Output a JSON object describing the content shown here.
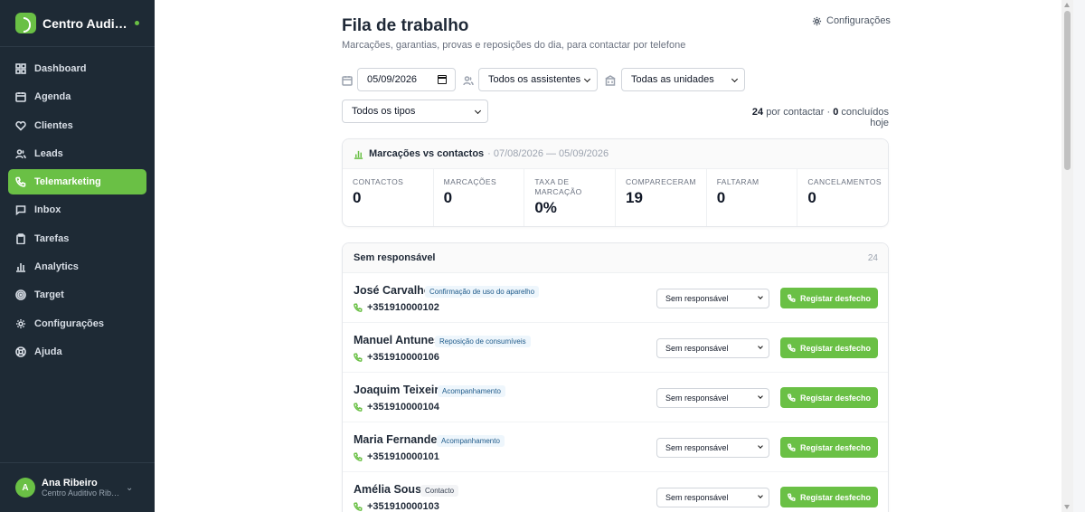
{
  "brand": {
    "name": "Centro Auditivo"
  },
  "nav": [
    {
      "label": "Dashboard",
      "icon": "dashboard-icon"
    },
    {
      "label": "Agenda",
      "icon": "calendar-icon"
    },
    {
      "label": "Clientes",
      "icon": "heart-icon"
    },
    {
      "label": "Leads",
      "icon": "users-icon"
    },
    {
      "label": "Telemarketing",
      "icon": "phone-icon",
      "active": true
    },
    {
      "label": "Inbox",
      "icon": "chat-icon"
    },
    {
      "label": "Tarefas",
      "icon": "clipboard-icon"
    },
    {
      "label": "Analytics",
      "icon": "bar-chart-icon"
    },
    {
      "label": "Target",
      "icon": "target-icon"
    },
    {
      "label": "Configurações",
      "icon": "gear-icon"
    },
    {
      "label": "Ajuda",
      "icon": "help-icon"
    }
  ],
  "user": {
    "initial": "A",
    "name": "Ana Ribeiro",
    "org": "Centro Auditivo Ribeiro"
  },
  "header": {
    "title": "Fila de trabalho",
    "subtitle": "Marcações, garantias, provas e reposições do dia, para contactar por telefone",
    "settings_label": "Configurações"
  },
  "filters": {
    "date": "05/09/2026",
    "assistants": "Todos os assistentes",
    "units": "Todas as unidades",
    "types": "Todos os tipos"
  },
  "counts": {
    "to_contact": "24",
    "to_contact_label": "por contactar ·",
    "done": "0",
    "done_label": "concluídos hoje"
  },
  "stats": {
    "title": "Marcações vs contactos",
    "range": "· 07/08/2026 — 05/09/2026",
    "items": [
      {
        "label": "Contactos",
        "value": "0"
      },
      {
        "label": "Marcações",
        "value": "0"
      },
      {
        "label": "Taxa de marcação",
        "value": "0%"
      },
      {
        "label": "Compareceram",
        "value": "19"
      },
      {
        "label": "Faltaram",
        "value": "0"
      },
      {
        "label": "Cancelamentos",
        "value": "0"
      }
    ]
  },
  "queue": {
    "group_title": "Sem responsável",
    "group_count": "24",
    "select_label": "Sem responsável",
    "button_label": "Registar desfecho",
    "rows": [
      {
        "name": "José Carvalho",
        "tag": "Confirmação de uso do aparelho",
        "phone": "+351910000102"
      },
      {
        "name": "Manuel Antunes",
        "tag": "Reposição de consumíveis",
        "phone": "+351910000106"
      },
      {
        "name": "Joaquim Teixeira",
        "tag": "Acompanhamento",
        "phone": "+351910000104"
      },
      {
        "name": "Maria Fernandes",
        "tag": "Acompanhamento",
        "phone": "+351910000101"
      },
      {
        "name": "Amélia Sousa",
        "tag": "Contacto",
        "phone": "+351910000103"
      }
    ]
  }
}
